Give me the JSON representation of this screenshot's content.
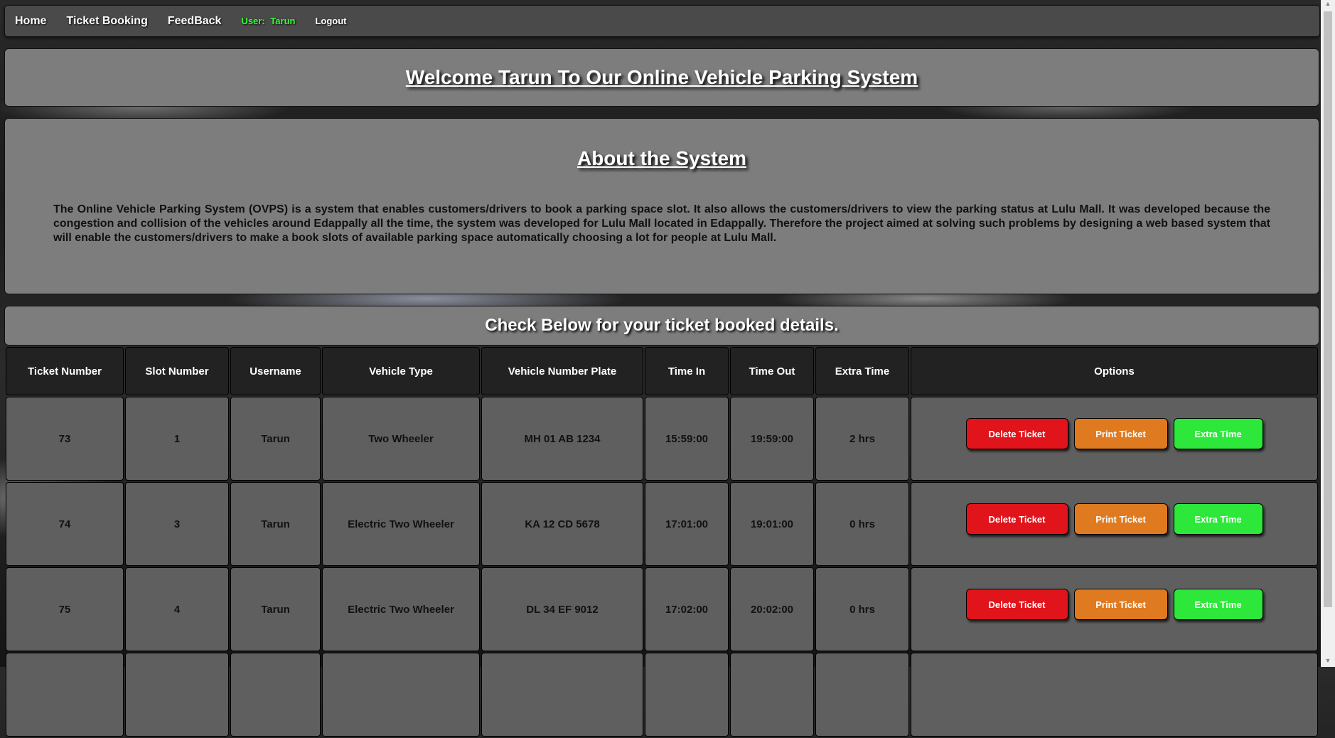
{
  "nav": {
    "home": "Home",
    "ticket_booking": "Ticket Booking",
    "feedback": "FeedBack",
    "user_label": "User:",
    "user_name": "Tarun",
    "logout": "Logout"
  },
  "welcome": {
    "title": "Welcome Tarun To Our Online Vehicle Parking System"
  },
  "about": {
    "title": "About the System",
    "text": "The Online Vehicle Parking System (OVPS) is a system that enables customers/drivers to book a parking space slot. It also allows the customers/drivers to view the parking status at Lulu Mall. It was developed because the congestion and collision of the vehicles around Edappally all the time, the system was developed for Lulu Mall located in Edappally. Therefore the project aimed at solving such problems by designing a web based system that will enable the customers/drivers to make a book slots of available parking space automatically choosing a lot for people at Lulu Mall."
  },
  "tickets_heading": "Check Below for your ticket booked details.",
  "table": {
    "headers": [
      "Ticket Number",
      "Slot Number",
      "Username",
      "Vehicle Type",
      "Vehicle Number Plate",
      "Time In",
      "Time Out",
      "Extra Time",
      "Options"
    ],
    "rows": [
      [
        "73",
        "1",
        "Tarun",
        "Two Wheeler",
        "MH 01 AB 1234",
        "15:59:00",
        "19:59:00",
        "2 hrs"
      ],
      [
        "74",
        "3",
        "Tarun",
        "Electric Two Wheeler",
        "KA 12 CD 5678",
        "17:01:00",
        "19:01:00",
        "0 hrs"
      ],
      [
        "75",
        "4",
        "Tarun",
        "Electric Two Wheeler",
        "DL 34 EF 9012",
        "17:02:00",
        "20:02:00",
        "0 hrs"
      ]
    ],
    "buttons": {
      "delete": "Delete Ticket",
      "print": "Print Ticket",
      "extra": "Extra Time"
    }
  },
  "colors": {
    "delete": "#e0141a",
    "print": "#e07a20",
    "extra": "#2de83a",
    "user": "#39ff39"
  }
}
